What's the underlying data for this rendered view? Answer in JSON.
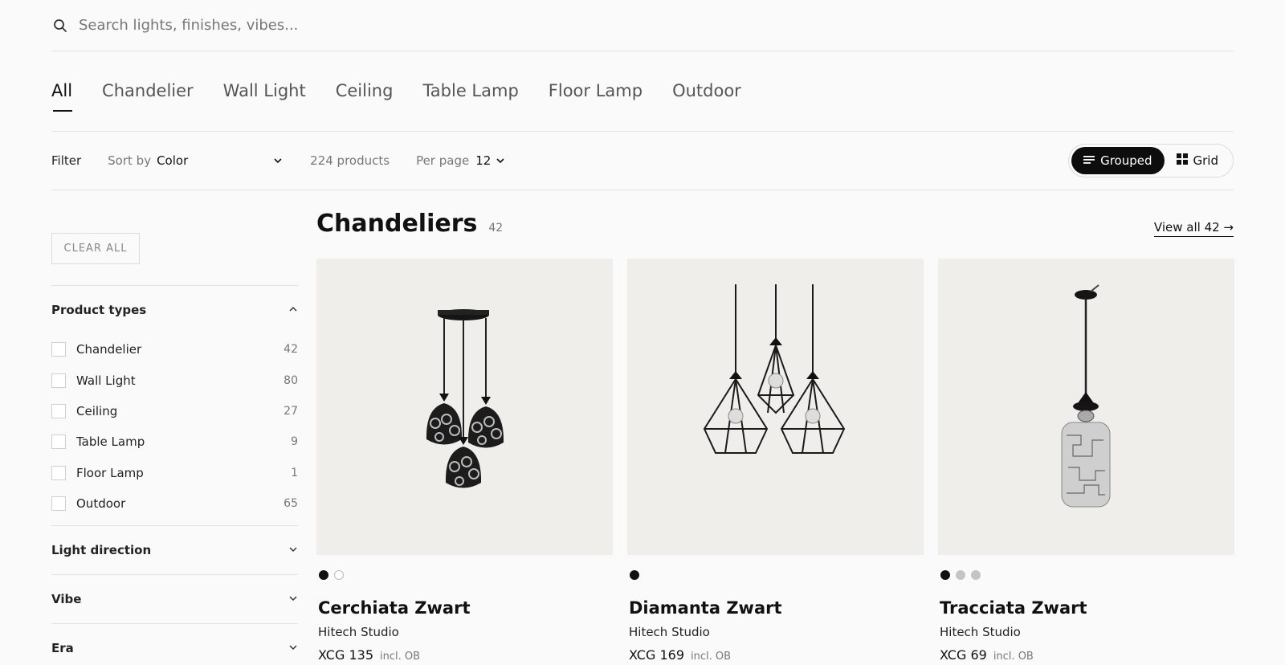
{
  "search": {
    "placeholder": "Search lights, finishes, vibes...",
    "icon": "search-icon"
  },
  "tabs": [
    {
      "label": "All",
      "active": true
    },
    {
      "label": "Chandelier"
    },
    {
      "label": "Wall Light"
    },
    {
      "label": "Ceiling"
    },
    {
      "label": "Table Lamp"
    },
    {
      "label": "Floor Lamp"
    },
    {
      "label": "Outdoor"
    }
  ],
  "toolbar": {
    "filter_label": "Filter",
    "sort_label": "Sort by",
    "sort_value": "Color",
    "product_count": "224 products",
    "per_page_label": "Per page",
    "per_page_value": "12",
    "view_grouped": "Grouped",
    "view_grid": "Grid",
    "active_view": "Grouped"
  },
  "sidebar": {
    "clear_all": "CLEAR ALL",
    "product_types": {
      "title": "Product types",
      "expanded": true,
      "options": [
        {
          "label": "Chandelier",
          "count": "42"
        },
        {
          "label": "Wall Light",
          "count": "80"
        },
        {
          "label": "Ceiling",
          "count": "27"
        },
        {
          "label": "Table Lamp",
          "count": "9"
        },
        {
          "label": "Floor Lamp",
          "count": "1"
        },
        {
          "label": "Outdoor",
          "count": "65"
        }
      ]
    },
    "light_direction": {
      "title": "Light direction",
      "expanded": false
    },
    "vibe": {
      "title": "Vibe",
      "expanded": false
    },
    "era": {
      "title": "Era",
      "expanded": false
    }
  },
  "main": {
    "category_title": "Chandeliers",
    "category_count": "42",
    "view_all": "View all 42 →",
    "products": [
      {
        "name": "Cerchiata Zwart",
        "brand": "Hitech Studio",
        "price": "XCG 135",
        "tax_note": "incl. OB",
        "swatches": [
          "#111111",
          "#ffffff"
        ]
      },
      {
        "name": "Diamanta Zwart",
        "brand": "Hitech Studio",
        "price": "XCG 169",
        "tax_note": "incl. OB",
        "swatches": [
          "#111111"
        ]
      },
      {
        "name": "Tracciata Zwart",
        "brand": "Hitech Studio",
        "price": "XCG 69",
        "tax_note": "incl. OB",
        "swatches": [
          "#111111",
          "#c4c4c4",
          "#c4c4c4"
        ]
      }
    ]
  },
  "colors": {
    "accent": "#0d0d0d",
    "background": "#fafafa",
    "image_bg": "#efeeeb",
    "divider": "#e2e2e2"
  }
}
